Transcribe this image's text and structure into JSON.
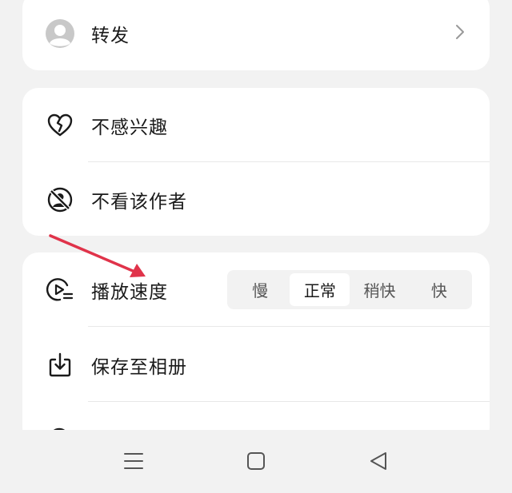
{
  "menu": {
    "forward": {
      "label": "转发",
      "icon": "avatar-icon"
    },
    "not_interested": {
      "label": "不感兴趣",
      "icon": "broken-heart-icon"
    },
    "hide_author": {
      "label": "不看该作者",
      "icon": "block-user-icon"
    },
    "playback_speed": {
      "label": "播放速度",
      "icon": "play-speed-icon",
      "options": [
        "慢",
        "正常",
        "稍快",
        "快"
      ],
      "selected": "正常"
    },
    "save_album": {
      "label": "保存至相册",
      "icon": "download-icon"
    },
    "partial_row": {
      "icon": "search-icon"
    }
  },
  "annotation": {
    "arrow_color": "#e0334a",
    "icon": "red-arrow-annotation"
  },
  "navbar": {
    "items": [
      "menu-icon",
      "home-icon",
      "back-icon"
    ]
  }
}
